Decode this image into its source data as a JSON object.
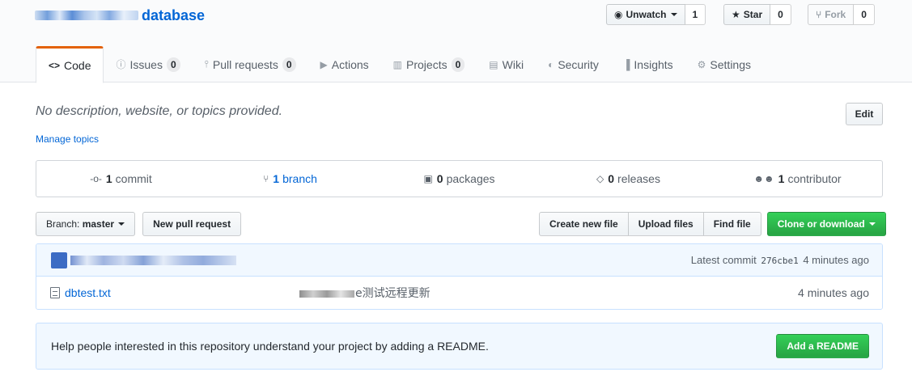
{
  "repo": {
    "name": "database"
  },
  "actions": {
    "watch": {
      "label": "Unwatch",
      "count": "1"
    },
    "star": {
      "label": "Star",
      "count": "0"
    },
    "fork": {
      "label": "Fork",
      "count": "0"
    }
  },
  "tabs": [
    {
      "label": "Code",
      "icon": "code-icon",
      "counter": ""
    },
    {
      "label": "Issues",
      "icon": "issue-icon",
      "counter": "0"
    },
    {
      "label": "Pull requests",
      "icon": "pull-request-icon",
      "counter": "0"
    },
    {
      "label": "Actions",
      "icon": "play-icon",
      "counter": ""
    },
    {
      "label": "Projects",
      "icon": "project-icon",
      "counter": "0"
    },
    {
      "label": "Wiki",
      "icon": "book-icon",
      "counter": ""
    },
    {
      "label": "Security",
      "icon": "shield-icon",
      "counter": ""
    },
    {
      "label": "Insights",
      "icon": "graph-icon",
      "counter": ""
    },
    {
      "label": "Settings",
      "icon": "gear-icon",
      "counter": ""
    }
  ],
  "about": {
    "description": "No description, website, or topics provided.",
    "edit_label": "Edit",
    "topics_link": "Manage topics"
  },
  "summary": {
    "commits": {
      "count": "1",
      "label": "commit"
    },
    "branches": {
      "count": "1",
      "label": "branch"
    },
    "packages": {
      "count": "0",
      "label": "packages"
    },
    "releases": {
      "count": "0",
      "label": "releases"
    },
    "contributors": {
      "count": "1",
      "label": "contributor"
    }
  },
  "filebar": {
    "branch_label": "Branch:",
    "branch_value": "master",
    "new_pr": "New pull request",
    "create_file": "Create new file",
    "upload_files": "Upload files",
    "find_file": "Find file",
    "clone": "Clone or download"
  },
  "latest_commit": {
    "prefix": "Latest commit",
    "sha": "276cbe1",
    "age": "4 minutes ago"
  },
  "files": [
    {
      "name": "dbtest.txt",
      "message_visible": "e测试远程更新",
      "age": "4 minutes ago"
    }
  ],
  "readme_prompt": {
    "text": "Help people interested in this repository understand your project by adding a README.",
    "button": "Add a README"
  },
  "colors": {
    "accent": "#e36209",
    "link": "#0366d6",
    "primary": "#28a745",
    "info_bg": "#f1f8ff"
  }
}
